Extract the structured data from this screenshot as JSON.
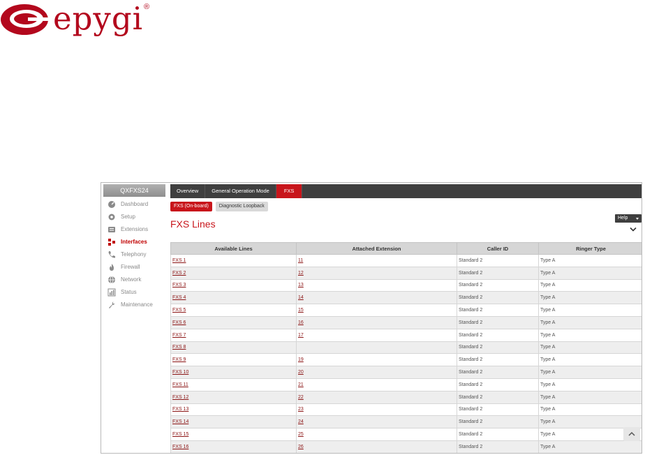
{
  "brand": {
    "name": "epygi",
    "reg": "®",
    "color": "#b3081d"
  },
  "sidebar": {
    "title": "QXFXS24",
    "items": [
      {
        "label": "Dashboard",
        "icon": "dashboard-icon"
      },
      {
        "label": "Setup",
        "icon": "gear-icon"
      },
      {
        "label": "Extensions",
        "icon": "extensions-icon"
      },
      {
        "label": "Interfaces",
        "icon": "interfaces-icon",
        "active": true
      },
      {
        "label": "Telephony",
        "icon": "phone-icon"
      },
      {
        "label": "Firewall",
        "icon": "flame-icon"
      },
      {
        "label": "Network",
        "icon": "globe-icon"
      },
      {
        "label": "Status",
        "icon": "chart-icon"
      },
      {
        "label": "Maintenance",
        "icon": "wrench-icon"
      }
    ]
  },
  "topnav": {
    "tabs": [
      {
        "label": "Overview"
      },
      {
        "label": "General Operation Mode"
      },
      {
        "label": "FXS",
        "active": true
      }
    ]
  },
  "subtabs": [
    {
      "label": "FXS (On-board)",
      "active": true
    },
    {
      "label": "Diagnostic Loopback",
      "active": false
    }
  ],
  "page": {
    "title": "FXS Lines",
    "help_label": "Help"
  },
  "table": {
    "headers": [
      "Available Lines",
      "Attached Extension",
      "Caller ID",
      "Ringer Type"
    ],
    "rows": [
      {
        "line": "FXS 1",
        "ext": "11",
        "caller": "Standard 2",
        "ringer": "Type A"
      },
      {
        "line": "FXS 2",
        "ext": "12",
        "caller": "Standard 2",
        "ringer": "Type A"
      },
      {
        "line": "FXS 3",
        "ext": "13",
        "caller": "Standard 2",
        "ringer": "Type A"
      },
      {
        "line": "FXS 4",
        "ext": "14",
        "caller": "Standard 2",
        "ringer": "Type A"
      },
      {
        "line": "FXS 5",
        "ext": "15",
        "caller": "Standard 2",
        "ringer": "Type A"
      },
      {
        "line": "FXS 6",
        "ext": "16",
        "caller": "Standard 2",
        "ringer": "Type A"
      },
      {
        "line": "FXS 7",
        "ext": "17",
        "caller": "Standard 2",
        "ringer": "Type A"
      },
      {
        "line": "FXS 8",
        "ext": "",
        "caller": "Standard 2",
        "ringer": "Type A"
      },
      {
        "line": "FXS 9",
        "ext": "19",
        "caller": "Standard 2",
        "ringer": "Type A"
      },
      {
        "line": "FXS 10",
        "ext": "20",
        "caller": "Standard 2",
        "ringer": "Type A"
      },
      {
        "line": "FXS 11",
        "ext": "21",
        "caller": "Standard 2",
        "ringer": "Type A"
      },
      {
        "line": "FXS 12",
        "ext": "22",
        "caller": "Standard 2",
        "ringer": "Type A"
      },
      {
        "line": "FXS 13",
        "ext": "23",
        "caller": "Standard 2",
        "ringer": "Type A"
      },
      {
        "line": "FXS 14",
        "ext": "24",
        "caller": "Standard 2",
        "ringer": "Type A"
      },
      {
        "line": "FXS 15",
        "ext": "25",
        "caller": "Standard 2",
        "ringer": "Type A"
      },
      {
        "line": "FXS 16",
        "ext": "26",
        "caller": "Standard 2",
        "ringer": "Type A"
      }
    ]
  },
  "colors": {
    "accent": "#c8151b",
    "nav_bg": "#3f3f3f",
    "link": "#8b1414"
  }
}
